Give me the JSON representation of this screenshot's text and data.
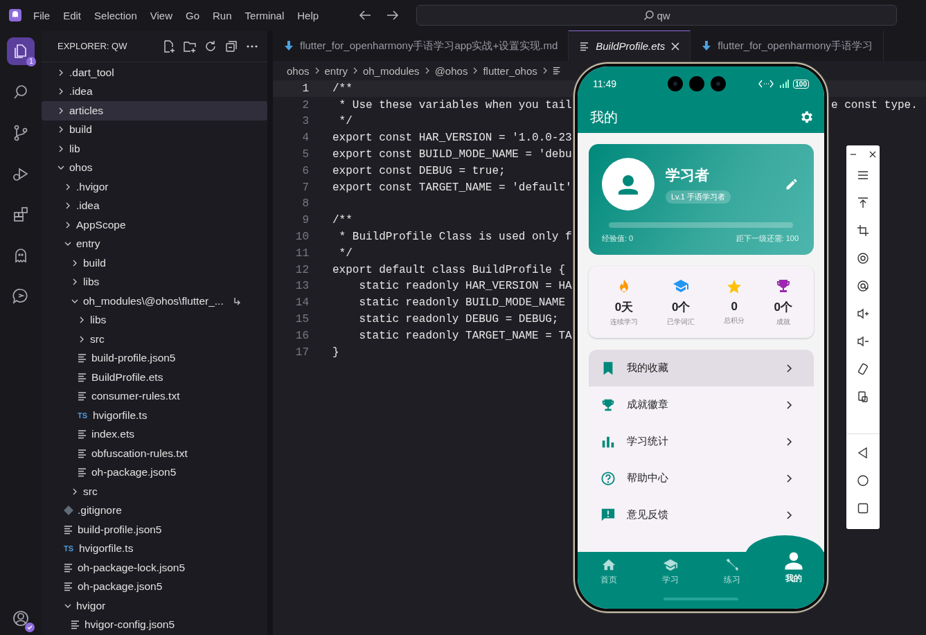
{
  "menu": [
    "File",
    "Edit",
    "Selection",
    "View",
    "Go",
    "Run",
    "Terminal",
    "Help"
  ],
  "command_center": {
    "value": "qw"
  },
  "activity": [
    {
      "kind": "explorer",
      "selected": true,
      "badge": "1"
    },
    {
      "kind": "search",
      "selected": false
    },
    {
      "kind": "scm",
      "selected": false
    },
    {
      "kind": "debug",
      "selected": false
    },
    {
      "kind": "extensions",
      "selected": false
    },
    {
      "kind": "ghost",
      "selected": false
    },
    {
      "kind": "chat",
      "selected": false
    }
  ],
  "sidebar": {
    "title": "EXPLORER: QW",
    "tree": [
      {
        "kind": "folder",
        "name": ".dart_tool",
        "expanded": false,
        "selected": false
      },
      {
        "kind": "folder",
        "name": ".idea",
        "expanded": false,
        "selected": false
      },
      {
        "kind": "folder",
        "name": "articles",
        "expanded": false,
        "selected": true
      },
      {
        "kind": "folder",
        "name": "build",
        "expanded": false,
        "selected": false
      },
      {
        "kind": "folder",
        "name": "lib",
        "expanded": false,
        "selected": false
      },
      {
        "kind": "folder",
        "name": "ohos",
        "expanded": true,
        "selected": false,
        "children": [
          {
            "kind": "folder",
            "name": ".hvigor",
            "expanded": false,
            "selected": false
          },
          {
            "kind": "folder",
            "name": ".idea",
            "expanded": false,
            "selected": false
          },
          {
            "kind": "folder",
            "name": "AppScope",
            "expanded": false,
            "selected": false
          },
          {
            "kind": "folder",
            "name": "entry",
            "expanded": true,
            "selected": false,
            "children": [
              {
                "kind": "folder",
                "name": "build",
                "expanded": false,
                "selected": false
              },
              {
                "kind": "folder",
                "name": "libs",
                "expanded": false,
                "selected": false
              },
              {
                "kind": "folder",
                "name": "oh_modules\\@ohos\\flutter_...",
                "expanded": true,
                "selected": false,
                "linked": true,
                "children": [
                  {
                    "kind": "folder",
                    "name": "libs",
                    "expanded": false,
                    "selected": false
                  },
                  {
                    "kind": "folder",
                    "name": "src",
                    "expanded": false,
                    "selected": false
                  },
                  {
                    "kind": "file",
                    "name": "build-profile.json5",
                    "selected": false
                  },
                  {
                    "kind": "file",
                    "name": "BuildProfile.ets",
                    "selected": false
                  },
                  {
                    "kind": "file",
                    "name": "consumer-rules.txt",
                    "selected": false
                  },
                  {
                    "kind": "ts",
                    "name": "hvigorfile.ts",
                    "icon_text": "TS",
                    "selected": false
                  },
                  {
                    "kind": "file",
                    "name": "index.ets",
                    "selected": false
                  },
                  {
                    "kind": "file",
                    "name": "obfuscation-rules.txt",
                    "selected": false
                  },
                  {
                    "kind": "file",
                    "name": "oh-package.json5",
                    "selected": false
                  }
                ]
              },
              {
                "kind": "folder",
                "name": "src",
                "expanded": false,
                "selected": false
              }
            ]
          },
          {
            "kind": "git",
            "name": ".gitignore",
            "selected": false
          },
          {
            "kind": "file",
            "name": "build-profile.json5",
            "selected": false
          },
          {
            "kind": "ts",
            "name": "hvigorfile.ts",
            "icon_text": "TS",
            "selected": false
          },
          {
            "kind": "file",
            "name": "oh-package-lock.json5",
            "selected": false
          },
          {
            "kind": "file",
            "name": "oh-package.json5",
            "selected": false
          },
          {
            "kind": "folder",
            "name": "hvigor",
            "expanded": true,
            "selected": false,
            "children": [
              {
                "kind": "file",
                "name": "hvigor-config.json5",
                "selected": false
              }
            ]
          }
        ]
      }
    ]
  },
  "tabs": [
    {
      "kind": "markdown",
      "label": "flutter_for_openharmony手语学习app实战+设置实现.md",
      "selected": false
    },
    {
      "kind": "file",
      "label": "BuildProfile.ets",
      "selected": true
    },
    {
      "kind": "markdown",
      "label": "flutter_for_openharmony手语学习",
      "selected": false
    }
  ],
  "breadcrumbs": [
    "ohos",
    "entry",
    "oh_modules",
    "@ohos",
    "flutter_ohos"
  ],
  "code": [
    {
      "number": "1",
      "text": "/**",
      "current": true
    },
    {
      "number": "2",
      "text": " * Use these variables when you tail",
      "tail": "e const type.",
      "current": false
    },
    {
      "number": "3",
      "text": " */",
      "current": false
    },
    {
      "number": "4",
      "text": "export const HAR_VERSION = '1.0.0-23",
      "current": false
    },
    {
      "number": "5",
      "text": "export const BUILD_MODE_NAME = 'debu",
      "current": false
    },
    {
      "number": "6",
      "text": "export const DEBUG = true;",
      "current": false
    },
    {
      "number": "7",
      "text": "export const TARGET_NAME = 'default'",
      "current": false
    },
    {
      "number": "8",
      "current": false
    },
    {
      "number": "9",
      "text": "/**",
      "current": false
    },
    {
      "number": "10",
      "text": " * BuildProfile Class is used only f",
      "current": false
    },
    {
      "number": "11",
      "text": " */",
      "current": false
    },
    {
      "number": "12",
      "text": "export default class BuildProfile {",
      "current": false
    },
    {
      "number": "13",
      "text": "    static readonly HAR_VERSION = HA",
      "current": false
    },
    {
      "number": "14",
      "text": "    static readonly BUILD_MODE_NAME",
      "current": false
    },
    {
      "number": "15",
      "text": "    static readonly DEBUG = DEBUG;",
      "current": false
    },
    {
      "number": "16",
      "text": "    static readonly TARGET_NAME = TA",
      "current": false
    },
    {
      "number": "17",
      "text": "}",
      "current": false
    }
  ],
  "phone": {
    "status": {
      "time": "11:49",
      "battery": "100"
    },
    "app_bar": {
      "title": "我的"
    },
    "profile": {
      "name": "学习者",
      "level_badge": "Lv.1 手语学习者",
      "progress": {
        "level": 0
      },
      "exp": "经验值: 0",
      "next": "距下一级还需: 100"
    },
    "stats": [
      {
        "kind": "fire",
        "color": "#ff9800",
        "value": "0天",
        "label": "连续学习"
      },
      {
        "kind": "school",
        "color": "#2196f3",
        "value": "0个",
        "label": "已学词汇"
      },
      {
        "kind": "star",
        "color": "#ffc107",
        "value": "0",
        "label": "总积分"
      },
      {
        "kind": "trophy",
        "color": "#9c27b0",
        "value": "0个",
        "label": "成就"
      }
    ],
    "menu": [
      {
        "kind": "bookmark",
        "label": "我的收藏",
        "selected": true
      },
      {
        "kind": "trophy",
        "label": "成就徽章",
        "selected": false
      },
      {
        "kind": "chart",
        "label": "学习统计",
        "selected": false
      },
      {
        "kind": "help",
        "label": "帮助中心",
        "selected": false
      },
      {
        "kind": "feedback",
        "label": "意见反馈",
        "selected": false
      }
    ],
    "nav": [
      {
        "kind": "home",
        "label": "首页",
        "selected": false
      },
      {
        "kind": "school",
        "label": "学习",
        "selected": false
      },
      {
        "kind": "fitness",
        "label": "练习",
        "selected": false
      },
      {
        "kind": "person",
        "label": "我的",
        "selected": true
      }
    ]
  }
}
